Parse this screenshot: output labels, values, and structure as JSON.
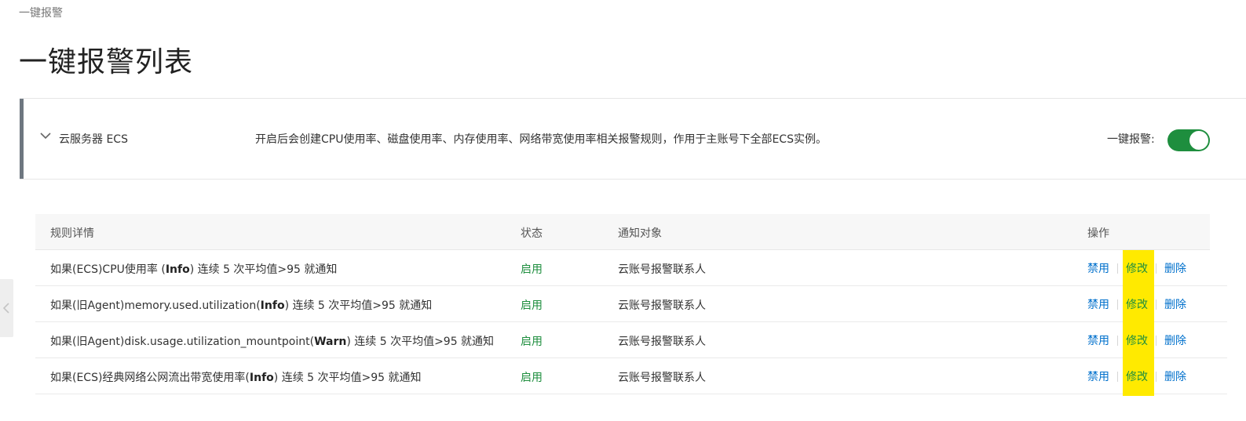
{
  "breadcrumb": "一键报警",
  "page_title": "一键报警列表",
  "panel": {
    "service_name": "云服务器 ECS",
    "description": "开启后会创建CPU使用率、磁盘使用率、内存使用率、网络带宽使用率相关报警规则，作用于主账号下全部ECS实例。",
    "toggle_label": "一键报警:",
    "toggle_on": true,
    "accent_color": "#1e8e3e"
  },
  "table": {
    "headers": {
      "rule": "规则详情",
      "status": "状态",
      "target": "通知对象",
      "ops": "操作"
    },
    "rows": [
      {
        "pre": "如果(ECS)CPU使用率 (",
        "level": "Info",
        "post": ") 连续 5 次平均值>95 就通知",
        "status": "启用",
        "target": "云账号报警联系人",
        "ops": {
          "disable": "禁用",
          "edit": "修改",
          "delete": "删除"
        }
      },
      {
        "pre": "如果(旧Agent)memory.used.utilization(",
        "level": "Info",
        "post": ") 连续 5 次平均值>95 就通知",
        "status": "启用",
        "target": "云账号报警联系人",
        "ops": {
          "disable": "禁用",
          "edit": "修改",
          "delete": "删除"
        }
      },
      {
        "pre": "如果(旧Agent)disk.usage.utilization_mountpoint(",
        "level": "Warn",
        "post": ") 连续 5 次平均值>95 就通知",
        "status": "启用",
        "target": "云账号报警联系人",
        "ops": {
          "disable": "禁用",
          "edit": "修改",
          "delete": "删除"
        }
      },
      {
        "pre": "如果(ECS)经典网络公网流出带宽使用率(",
        "level": "Info",
        "post": ") 连续 5 次平均值>95 就通知",
        "status": "启用",
        "target": "云账号报警联系人",
        "ops": {
          "disable": "禁用",
          "edit": "修改",
          "delete": "删除"
        }
      }
    ]
  },
  "icons": {
    "chevron": "chevron-down-icon",
    "side": "chevron-left-icon"
  },
  "colors": {
    "status_enabled": "#1e8e3e",
    "link": "#0070cc",
    "highlight": "#ffea00"
  }
}
